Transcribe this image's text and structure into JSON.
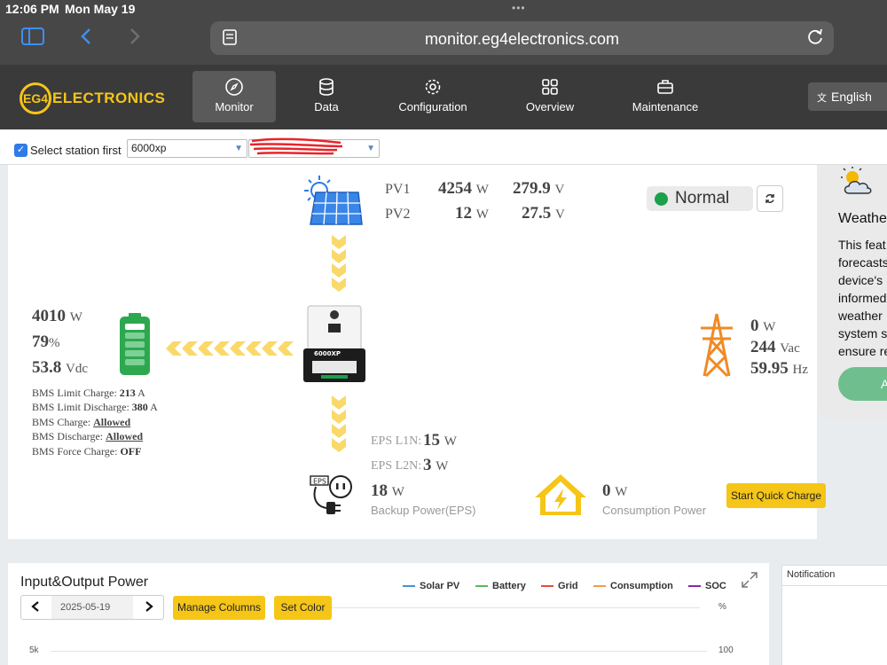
{
  "statusbar": {
    "time": "12:06 PM",
    "date": "Mon May 19",
    "dots": "•••"
  },
  "browser": {
    "url": "monitor.eg4electronics.com"
  },
  "header": {
    "logo_text": "ELECTRONICS",
    "logo_mark": "EG4",
    "menu": [
      {
        "label": "Monitor",
        "icon": "compass-icon"
      },
      {
        "label": "Data",
        "icon": "database-icon"
      },
      {
        "label": "Configuration",
        "icon": "gear-icon"
      },
      {
        "label": "Overview",
        "icon": "grid-icon"
      },
      {
        "label": "Maintenance",
        "icon": "briefcase-icon"
      }
    ],
    "language": "English"
  },
  "station": {
    "checkbox_label": "Select station first",
    "selected": "6000xp",
    "checked": true
  },
  "pv": {
    "pv1": {
      "label": "PV1",
      "power": "4254",
      "power_unit": "W",
      "voltage": "279.9",
      "voltage_unit": "V"
    },
    "pv2": {
      "label": "PV2",
      "power": "12",
      "power_unit": "W",
      "voltage": "27.5",
      "voltage_unit": "V"
    }
  },
  "status": {
    "label": "Normal",
    "color": "#1aa14a"
  },
  "battery": {
    "power": "4010",
    "power_unit": "W",
    "soc": "79",
    "soc_unit": "%",
    "voltage": "53.8",
    "voltage_unit": "Vdc",
    "bms": [
      {
        "label": "BMS Limit Charge:",
        "value": "213",
        "unit": "A"
      },
      {
        "label": "BMS Limit Discharge:",
        "value": "380",
        "unit": "A"
      },
      {
        "label": "BMS Charge:",
        "value": "Allowed",
        "unit": ""
      },
      {
        "label": "BMS Discharge:",
        "value": "Allowed",
        "unit": ""
      },
      {
        "label": "BMS Force Charge:",
        "value": "OFF",
        "unit": ""
      }
    ]
  },
  "inverter": {
    "model_label": "6000XP"
  },
  "grid": {
    "power": "0",
    "power_unit": "W",
    "voltage": "244",
    "voltage_unit": "Vac",
    "frequency": "59.95",
    "frequency_unit": "Hz"
  },
  "eps": {
    "l1n_label": "EPS L1N:",
    "l1n_value": "15",
    "l1n_unit": "W",
    "l2n_label": "EPS L2N:",
    "l2n_value": "3",
    "l2n_unit": "W",
    "icon_label": "EPS",
    "power": "18",
    "power_unit": "W",
    "caption": "Backup Power(EPS)"
  },
  "consumption": {
    "power": "0",
    "power_unit": "W",
    "caption": "Consumption Power"
  },
  "quick_charge": {
    "label": "Start Quick Charge"
  },
  "weather": {
    "title": "Weathe",
    "lines": [
      "This feat",
      "forecasts",
      "device's",
      "informed",
      "weather",
      "system s",
      "ensure re"
    ],
    "button": "A"
  },
  "chart": {
    "title": "Input&Output Power",
    "date": "2025-05-19",
    "manage_columns": "Manage Columns",
    "set_color": "Set Color",
    "legend": [
      {
        "name": "Solar PV",
        "color": "#4a90d9"
      },
      {
        "name": "Battery",
        "color": "#5cb85c"
      },
      {
        "name": "Grid",
        "color": "#e74c3c"
      },
      {
        "name": "Consumption",
        "color": "#f39c4a"
      },
      {
        "name": "SOC",
        "color": "#8e24aa"
      }
    ],
    "y_left_tick": "5k",
    "y_right_unit": "%",
    "y_right_tick": "100"
  },
  "notification": {
    "title": "Notification"
  },
  "colors": {
    "accent": "#f5c518",
    "flow_arrow": "#f8d96a"
  }
}
